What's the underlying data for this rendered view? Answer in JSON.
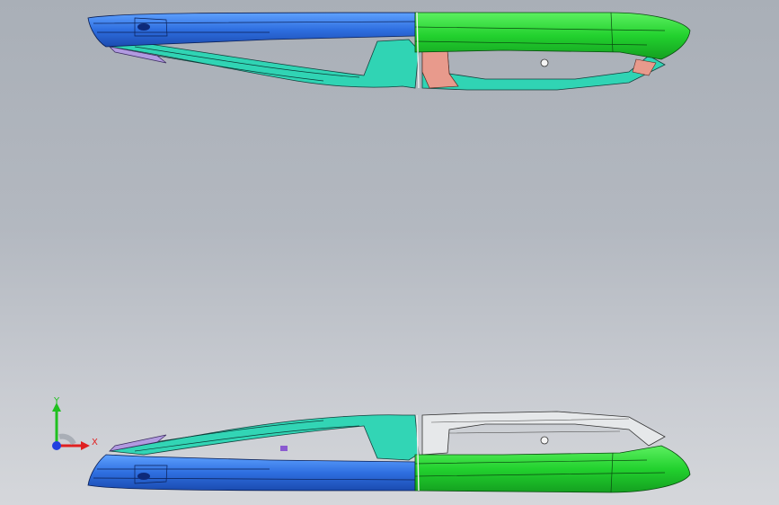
{
  "viewport": {
    "background_top": "#a9afb7",
    "background_bottom": "#d5d7db"
  },
  "model": {
    "colors": {
      "left_body": "#2f6fe0",
      "right_body": "#22d12e",
      "frame": "#2ad6b4",
      "frame_dark": "#0c3a36",
      "bracket": "#e89a8c",
      "accent": "#8a5ad0"
    }
  },
  "triad": {
    "x_label": "X",
    "y_label": "Y",
    "x_color": "#e02020",
    "y_color": "#20c020",
    "origin_color": "#2040e0"
  }
}
